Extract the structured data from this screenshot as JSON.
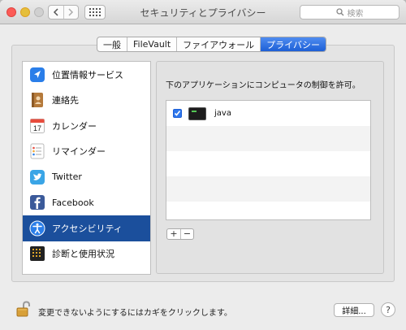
{
  "window": {
    "title": "セキュリティとプライバシー"
  },
  "search": {
    "placeholder": "検索"
  },
  "tabs": [
    {
      "label": "一般"
    },
    {
      "label": "FileVault"
    },
    {
      "label": "ファイアウォール"
    },
    {
      "label": "プライバシー",
      "active": true
    }
  ],
  "sidebar": {
    "items": [
      {
        "label": "位置情報サービス",
        "icon": "location-arrow-icon"
      },
      {
        "label": "連絡先",
        "icon": "contacts-book-icon"
      },
      {
        "label": "カレンダー",
        "icon": "calendar-icon",
        "icon_text": "17"
      },
      {
        "label": "リマインダー",
        "icon": "reminders-list-icon"
      },
      {
        "label": "Twitter",
        "icon": "twitter-bird-icon"
      },
      {
        "label": "Facebook",
        "icon": "facebook-f-icon"
      },
      {
        "label": "アクセシビリティ",
        "icon": "accessibility-icon",
        "selected": true
      },
      {
        "label": "診断と使用状況",
        "icon": "diagnostics-icon"
      }
    ]
  },
  "main": {
    "instruction": "下のアプリケーションにコンピュータの制御を許可。",
    "apps": [
      {
        "name": "java",
        "checked": true
      }
    ],
    "add_label": "+",
    "remove_label": "−"
  },
  "footer": {
    "lock_text": "変更できないようにするにはカギをクリックします。",
    "details_label": "詳細...",
    "help_label": "?"
  },
  "colors": {
    "accent": "#1d5fd6",
    "selection": "#1b4f9c",
    "close": "#fc5b57",
    "minimize": "#e5bf3c"
  }
}
